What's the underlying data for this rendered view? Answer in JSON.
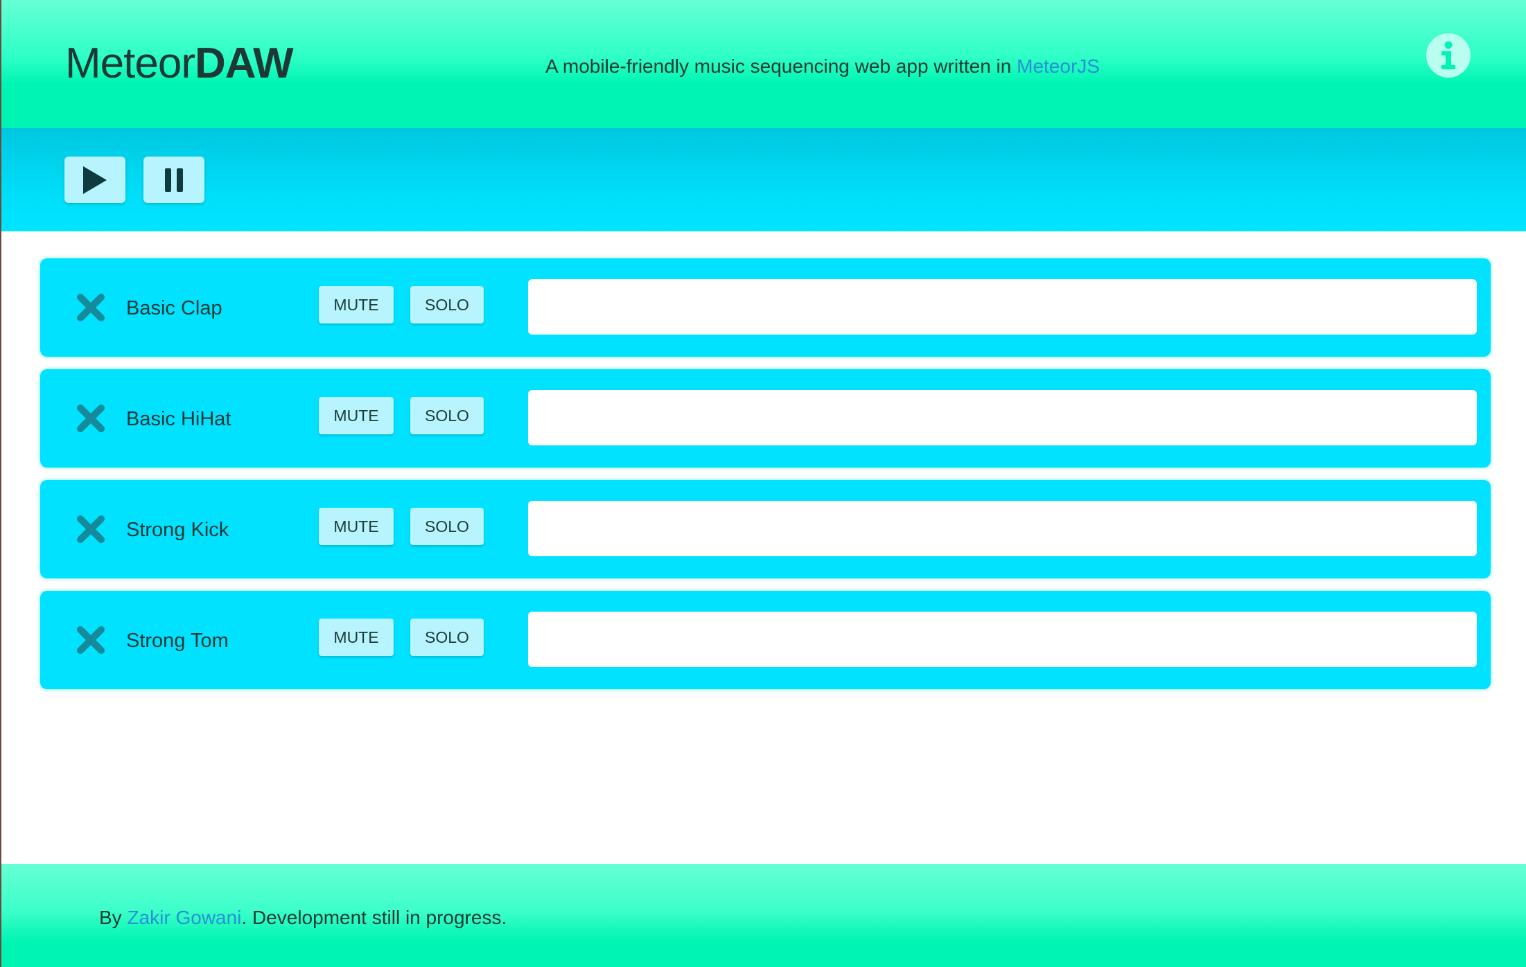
{
  "header": {
    "brand_light": "Meteor",
    "brand_bold": "DAW",
    "tagline_prefix": "A mobile-friendly music sequencing web app written in ",
    "tagline_link": "MeteorJS",
    "info_icon": "info-icon"
  },
  "transport": {
    "play_icon": "play-icon",
    "pause_icon": "pause-icon"
  },
  "tracks": [
    {
      "name": "Basic Clap",
      "mute_label": "MUTE",
      "solo_label": "SOLO"
    },
    {
      "name": "Basic HiHat",
      "mute_label": "MUTE",
      "solo_label": "SOLO"
    },
    {
      "name": "Strong Kick",
      "mute_label": "MUTE",
      "solo_label": "SOLO"
    },
    {
      "name": "Strong Tom",
      "mute_label": "MUTE",
      "solo_label": "SOLO"
    }
  ],
  "footer": {
    "prefix": "By ",
    "author_link": "Zakir Gowani",
    "suffix": ". Development still in progress."
  },
  "colors": {
    "header_green": "#00f5b4",
    "track_cyan": "#00e2ff",
    "button_bg": "#b7f4fd",
    "link_blue": "#2a8fd6",
    "remove_x": "#148a9a"
  }
}
